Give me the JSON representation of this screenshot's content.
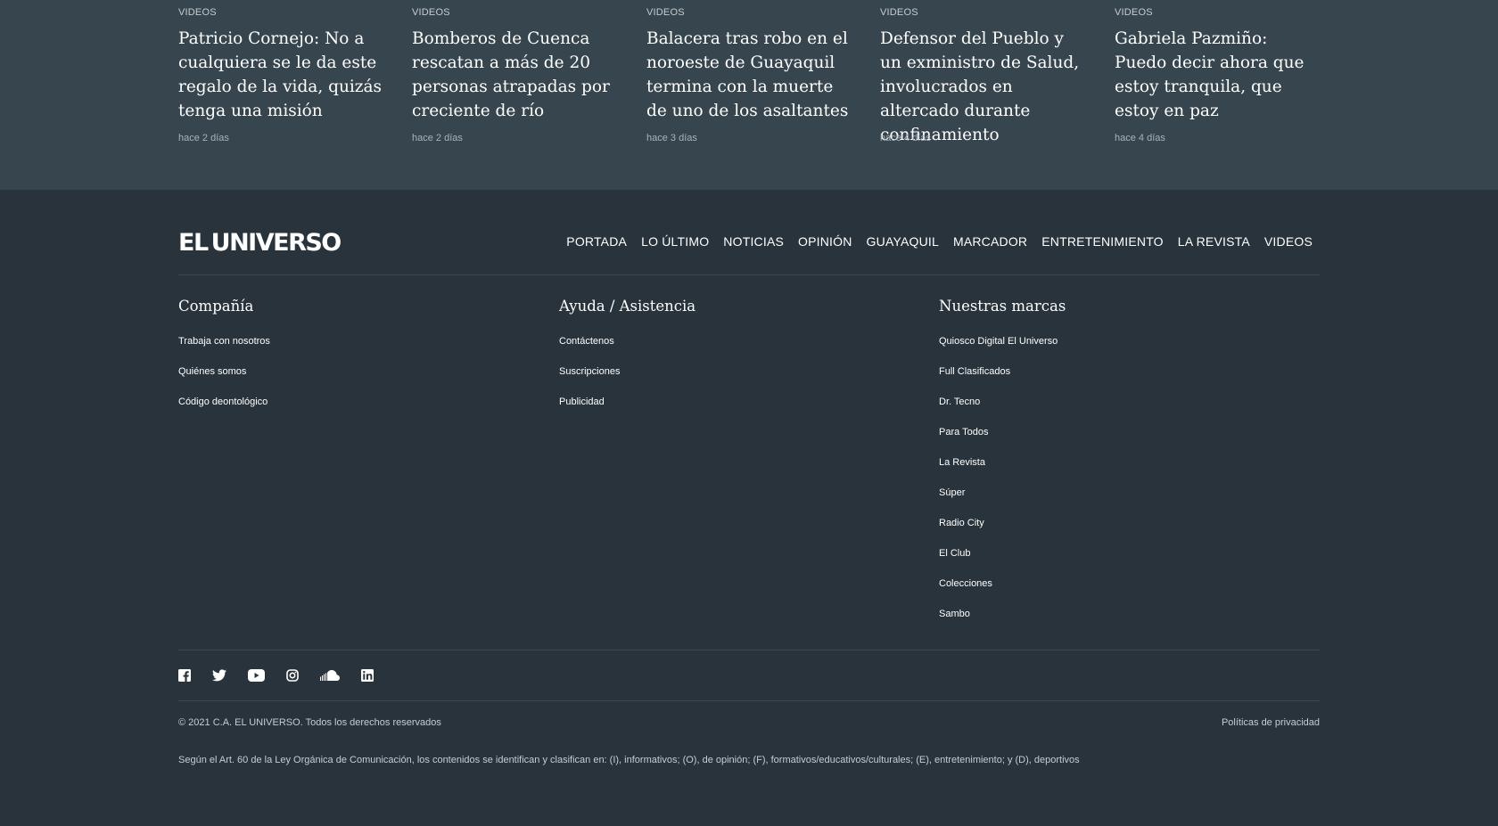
{
  "related": [
    {
      "category": "VIDEOS",
      "title": "Patricio Cornejo: No a cualquiera se le da este regalo de la vida, quizás tenga una misión",
      "time": "hace 2 días"
    },
    {
      "category": "VIDEOS",
      "title": "Bomberos de Cuenca rescatan a más de 20 personas atrapadas por creciente de río",
      "time": "hace 2 días"
    },
    {
      "category": "VIDEOS",
      "title": "Balacera tras robo en el noroeste de Guayaquil termina con la muerte de uno de los asaltantes",
      "time": "hace 3 días"
    },
    {
      "category": "VIDEOS",
      "title": "Defensor del Pueblo y un exministro de Salud, involucrados en altercado durante confinamiento",
      "time": "hace 4 días"
    },
    {
      "category": "VIDEOS",
      "title": "Gabriela Pazmiño: Puedo decir ahora que estoy tranquila, que estoy en paz",
      "time": "hace 4 días"
    }
  ],
  "footer": {
    "logo_left": "EL",
    "logo_right": "UNIVERSO",
    "nav": [
      "PORTADA",
      "LO ÚLTIMO",
      "NOTICIAS",
      "OPINIÓN",
      "GUAYAQUIL",
      "MARCADOR",
      "ENTRETENIMIENTO",
      "LA REVISTA",
      "VIDEOS"
    ],
    "columns": [
      {
        "title": "Compañía",
        "items": [
          "Trabaja con nosotros",
          "Quiénes somos",
          "Código deontológico"
        ]
      },
      {
        "title": "Ayuda / Asistencia",
        "items": [
          "Contáctenos",
          "Suscripciones",
          "Publicidad"
        ]
      },
      {
        "title": "Nuestras marcas",
        "items": [
          "Quiosco Digital El Universo",
          "Full Clasificados",
          "Dr. Tecno",
          "Para Todos",
          "La Revista",
          "Súper",
          "Radio City",
          "El Club",
          "Colecciones",
          "Sambo"
        ]
      }
    ],
    "social_icons": [
      "facebook-icon",
      "twitter-icon",
      "youtube-icon",
      "instagram-icon",
      "soundcloud-icon",
      "linkedin-icon"
    ],
    "copyright": "© 2021 C.A. EL UNIVERSO. Todos los derechos reservados",
    "privacy": "Políticas de privacidad",
    "legal": "Según el Art. 60 de la Ley Orgánica de Comunicación, los contenidos se identifican y clasifican en: (I), informativos; (O), de opinión; (F), formativos/educativos/culturales; (E), entretenimiento; y (D), deportivos"
  },
  "colors": {
    "top_background": "#37454e",
    "footer_background": "#28333b",
    "divider": "#3c4952",
    "muted_text": "#c7cdd1"
  }
}
